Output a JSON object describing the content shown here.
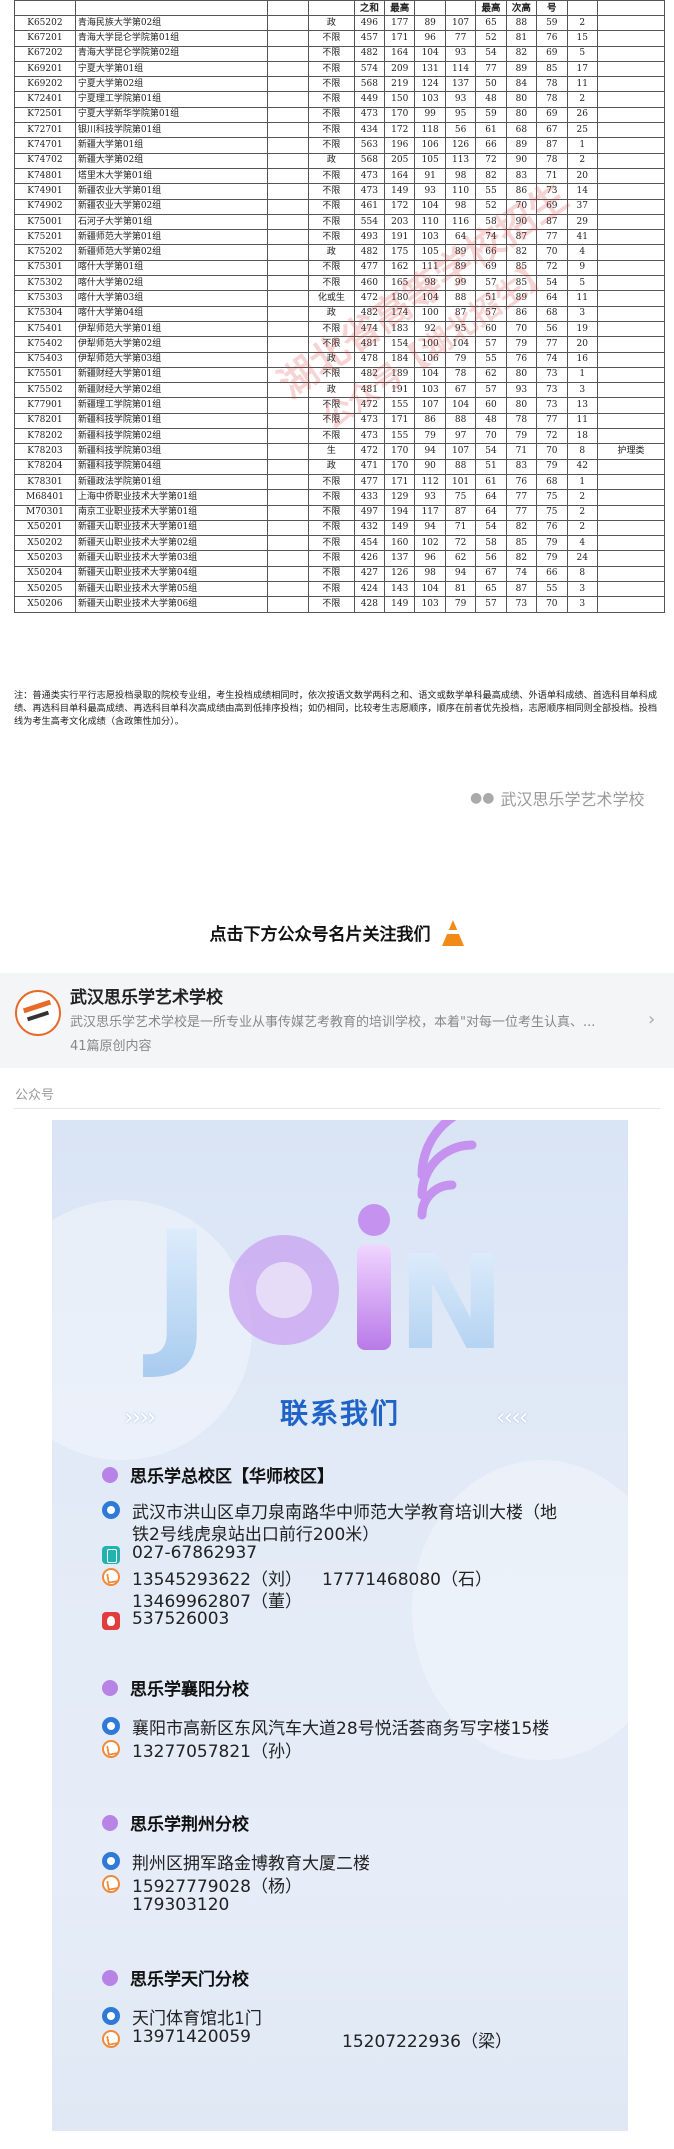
{
  "table": {
    "header": [
      "",
      "",
      "",
      "",
      "之和",
      "最高",
      "",
      "",
      "最高",
      "次高",
      "号",
      ""
    ],
    "rows": [
      [
        "K65202",
        "青海民族大学第02组",
        "",
        "政",
        "496",
        "177",
        "89",
        "107",
        "65",
        "88",
        "59",
        "2",
        ""
      ],
      [
        "K67201",
        "青海大学昆仑学院第01组",
        "",
        "不限",
        "457",
        "171",
        "96",
        "77",
        "52",
        "81",
        "76",
        "15",
        ""
      ],
      [
        "K67202",
        "青海大学昆仑学院第02组",
        "",
        "不限",
        "482",
        "164",
        "104",
        "93",
        "54",
        "82",
        "69",
        "5",
        ""
      ],
      [
        "K69201",
        "宁夏大学第01组",
        "",
        "不限",
        "574",
        "209",
        "131",
        "114",
        "77",
        "89",
        "85",
        "17",
        ""
      ],
      [
        "K69202",
        "宁夏大学第02组",
        "",
        "不限",
        "568",
        "219",
        "124",
        "137",
        "50",
        "84",
        "78",
        "11",
        ""
      ],
      [
        "K72401",
        "宁夏理工学院第01组",
        "",
        "不限",
        "449",
        "150",
        "103",
        "93",
        "48",
        "80",
        "78",
        "2",
        ""
      ],
      [
        "K72501",
        "宁夏大学新华学院第01组",
        "",
        "不限",
        "473",
        "170",
        "99",
        "95",
        "59",
        "80",
        "69",
        "26",
        ""
      ],
      [
        "K72701",
        "银川科技学院第01组",
        "",
        "不限",
        "434",
        "172",
        "118",
        "56",
        "61",
        "68",
        "67",
        "25",
        ""
      ],
      [
        "K74701",
        "新疆大学第01组",
        "",
        "不限",
        "563",
        "196",
        "106",
        "126",
        "66",
        "89",
        "87",
        "1",
        ""
      ],
      [
        "K74702",
        "新疆大学第02组",
        "",
        "政",
        "568",
        "205",
        "105",
        "113",
        "72",
        "90",
        "78",
        "2",
        ""
      ],
      [
        "K74801",
        "塔里木大学第01组",
        "",
        "不限",
        "473",
        "164",
        "91",
        "98",
        "82",
        "83",
        "71",
        "20",
        ""
      ],
      [
        "K74901",
        "新疆农业大学第01组",
        "",
        "不限",
        "473",
        "149",
        "93",
        "110",
        "55",
        "86",
        "73",
        "14",
        ""
      ],
      [
        "K74902",
        "新疆农业大学第02组",
        "",
        "不限",
        "461",
        "172",
        "104",
        "98",
        "52",
        "70",
        "69",
        "37",
        ""
      ],
      [
        "K75001",
        "石河子大学第01组",
        "",
        "不限",
        "554",
        "203",
        "110",
        "116",
        "58",
        "90",
        "87",
        "29",
        ""
      ],
      [
        "K75201",
        "新疆师范大学第01组",
        "",
        "不限",
        "493",
        "191",
        "103",
        "64",
        "74",
        "87",
        "77",
        "41",
        ""
      ],
      [
        "K75202",
        "新疆师范大学第02组",
        "",
        "政",
        "482",
        "175",
        "105",
        "89",
        "66",
        "82",
        "70",
        "4",
        ""
      ],
      [
        "K75301",
        "喀什大学第01组",
        "",
        "不限",
        "477",
        "162",
        "111",
        "89",
        "69",
        "85",
        "72",
        "9",
        ""
      ],
      [
        "K75302",
        "喀什大学第02组",
        "",
        "不限",
        "460",
        "165",
        "98",
        "99",
        "57",
        "85",
        "54",
        "5",
        ""
      ],
      [
        "K75303",
        "喀什大学第03组",
        "",
        "化或生",
        "472",
        "180",
        "104",
        "88",
        "51",
        "89",
        "64",
        "11",
        ""
      ],
      [
        "K75304",
        "喀什大学第04组",
        "",
        "政",
        "482",
        "174",
        "100",
        "87",
        "57",
        "86",
        "68",
        "3",
        ""
      ],
      [
        "K75401",
        "伊犁师范大学第01组",
        "",
        "不限",
        "474",
        "183",
        "92",
        "95",
        "60",
        "70",
        "56",
        "19",
        ""
      ],
      [
        "K75402",
        "伊犁师范大学第02组",
        "",
        "不限",
        "481",
        "154",
        "100",
        "104",
        "57",
        "79",
        "77",
        "20",
        ""
      ],
      [
        "K75403",
        "伊犁师范大学第03组",
        "",
        "政",
        "478",
        "184",
        "106",
        "79",
        "55",
        "76",
        "74",
        "16",
        ""
      ],
      [
        "K75501",
        "新疆财经大学第01组",
        "",
        "不限",
        "482",
        "189",
        "104",
        "78",
        "62",
        "80",
        "73",
        "1",
        ""
      ],
      [
        "K75502",
        "新疆财经大学第02组",
        "",
        "政",
        "481",
        "191",
        "103",
        "67",
        "57",
        "93",
        "73",
        "3",
        ""
      ],
      [
        "K77901",
        "新疆理工学院第01组",
        "",
        "不限",
        "472",
        "155",
        "107",
        "104",
        "60",
        "80",
        "73",
        "13",
        ""
      ],
      [
        "K78201",
        "新疆科技学院第01组",
        "",
        "不限",
        "473",
        "171",
        "86",
        "88",
        "48",
        "78",
        "77",
        "11",
        ""
      ],
      [
        "K78202",
        "新疆科技学院第02组",
        "",
        "不限",
        "473",
        "155",
        "79",
        "97",
        "70",
        "79",
        "72",
        "18",
        ""
      ],
      [
        "K78203",
        "新疆科技学院第03组",
        "",
        "生",
        "472",
        "170",
        "94",
        "107",
        "54",
        "71",
        "70",
        "8",
        "护理类"
      ],
      [
        "K78204",
        "新疆科技学院第04组",
        "",
        "政",
        "471",
        "170",
        "90",
        "88",
        "51",
        "83",
        "79",
        "42",
        ""
      ],
      [
        "K78301",
        "新疆政法学院第01组",
        "",
        "不限",
        "477",
        "171",
        "112",
        "101",
        "61",
        "76",
        "68",
        "1",
        ""
      ],
      [
        "M68401",
        "上海中侨职业技术大学第01组",
        "",
        "不限",
        "433",
        "129",
        "93",
        "75",
        "64",
        "77",
        "75",
        "2",
        ""
      ],
      [
        "M70301",
        "南京工业职业技术大学第01组",
        "",
        "不限",
        "497",
        "194",
        "117",
        "87",
        "64",
        "77",
        "75",
        "2",
        ""
      ],
      [
        "X50201",
        "新疆天山职业技术大学第01组",
        "",
        "不限",
        "432",
        "149",
        "94",
        "71",
        "54",
        "82",
        "76",
        "2",
        ""
      ],
      [
        "X50202",
        "新疆天山职业技术大学第02组",
        "",
        "不限",
        "454",
        "160",
        "102",
        "72",
        "58",
        "85",
        "79",
        "4",
        ""
      ],
      [
        "X50203",
        "新疆天山职业技术大学第03组",
        "",
        "不限",
        "426",
        "137",
        "96",
        "62",
        "56",
        "82",
        "79",
        "24",
        ""
      ],
      [
        "X50204",
        "新疆天山职业技术大学第04组",
        "",
        "不限",
        "427",
        "126",
        "98",
        "94",
        "67",
        "74",
        "66",
        "8",
        ""
      ],
      [
        "X50205",
        "新疆天山职业技术大学第05组",
        "",
        "不限",
        "424",
        "143",
        "104",
        "81",
        "65",
        "87",
        "55",
        "3",
        ""
      ],
      [
        "X50206",
        "新疆天山职业技术大学第06组",
        "",
        "不限",
        "428",
        "149",
        "103",
        "79",
        "57",
        "73",
        "70",
        "3",
        ""
      ]
    ]
  },
  "note": "注：普通类实行平行志愿投档录取的院校专业组，考生投档成绩相同时，依次按语文数学两科之和、语文或数学单科最高成绩、外语单科成绩、首选科目单科成绩、再选科目单科最高成绩、再选科目单科次高成绩由高到低排序投档；如仍相同，比较考生志愿顺序，顺序在前者优先投档，志愿顺序相同则全部投档。投档线为考生高考文化成绩（含政策性加分）。",
  "brand_mark": "武汉思乐学艺术学校",
  "follow_prompt": "点击下方公众号名片关注我们",
  "account_card": {
    "name": "武汉思乐学艺术学校",
    "description": "武汉思乐学艺术学校是一所专业从事传媒艺考教育的培训学校，本着\"对每一位考生认真、...",
    "count": "41篇原创内容",
    "tag": "公众号"
  },
  "poster": {
    "join_word": "JoiN",
    "title": "联系我们",
    "campuses": [
      {
        "name": "思乐学总校区【华师校区】",
        "address_1": "武汉市洪山区卓刀泉南路华中师范大学教育培训大楼（地",
        "address_2": "铁2号线虎泉站出口前行200米）",
        "tel": "027-67862937",
        "mobile_1": "13545293622（刘）",
        "mobile_2": "17771468080（石）",
        "mobile_3": "13469962807（董）",
        "qq": "537526003"
      },
      {
        "name": "思乐学襄阳分校",
        "address": "襄阳市高新区东风汽车大道28号悦活荟商务写字楼15楼",
        "mobile_1": "13277057821（孙）"
      },
      {
        "name": "思乐学荆州分校",
        "address": "荆州区拥军路金博教育大厦二楼",
        "mobile_1": "15927779028（杨）",
        "mobile_2": "179303120"
      },
      {
        "name": "思乐学天门分校",
        "address": "天门体育馆北1门",
        "mobile_1": "13971420059",
        "mobile_2": "15207222936（梁）"
      }
    ]
  },
  "colors": {
    "accent_blue": "#1f63c7",
    "dot_purple": "#b883e6",
    "watermark_red": "#d73c3c",
    "cone_orange": "#f28a18"
  }
}
